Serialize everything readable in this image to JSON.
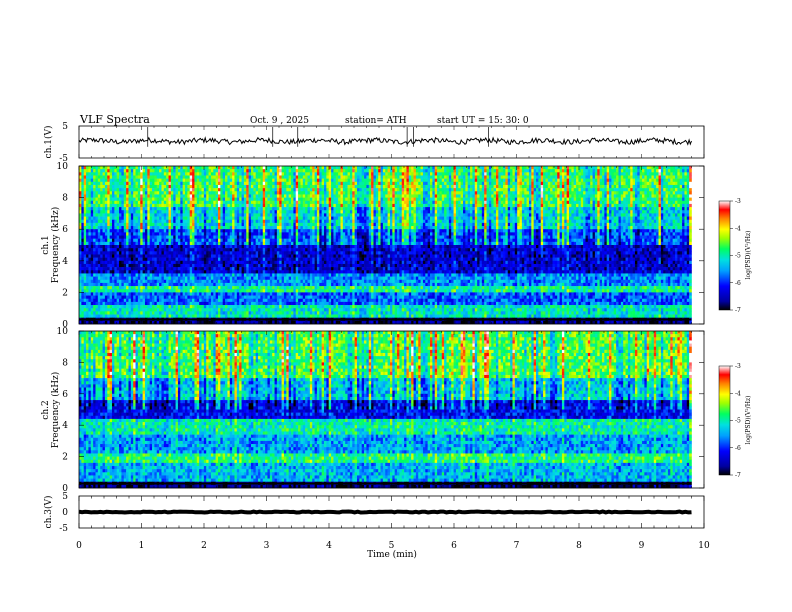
{
  "header": {
    "title": "VLF  Spectra",
    "date": "Oct. 9  , 2025",
    "station": "station= ATH",
    "start_ut": "start  UT  =    15: 30: 0"
  },
  "colors": {
    "background": "#ffffff",
    "axis": "#000000",
    "colormap": [
      "#000000",
      "#0000a0",
      "#0000ff",
      "#00a0ff",
      "#00e0e0",
      "#00ff60",
      "#a0ff00",
      "#ffff00",
      "#ff8000",
      "#ff0000",
      "#ffffff"
    ]
  },
  "chart_data": [
    {
      "type": "line",
      "panel": "ch1-waveform",
      "ylabel": "ch.1(V)",
      "xlim": [
        0,
        10
      ],
      "ylim": [
        -5,
        5
      ],
      "yticks": [
        "5",
        "-5"
      ],
      "trace_range_min": [
        0,
        9.8
      ],
      "baseline_v": 0.3,
      "noise_amplitude_v": 0.8,
      "spike_times_min": [
        1.1,
        3.1,
        3.5,
        5.25,
        5.35,
        6.55
      ]
    },
    {
      "type": "heatmap",
      "panel": "ch1-spectrogram",
      "ylabel_top": "ch.1",
      "ylabel": "Frequency  (kHz)",
      "xlim": [
        0,
        10
      ],
      "ylim": [
        0,
        10
      ],
      "yticks": [
        "0",
        "2",
        "4",
        "6",
        "8",
        "10"
      ],
      "data_extent_min": [
        0,
        9.8
      ],
      "colorbar": {
        "label": "log(PSD)(V²/Hz)",
        "ticks": [
          "-3",
          "-4",
          "-5",
          "-6",
          "-7"
        ],
        "range": [
          -7,
          -3
        ]
      },
      "bands_khz": [
        {
          "from": 0,
          "to": 0.4,
          "log_psd": -6.8
        },
        {
          "from": 0.4,
          "to": 1.3,
          "log_psd": -5.1
        },
        {
          "from": 1.3,
          "to": 2.0,
          "log_psd": -5.8
        },
        {
          "from": 2.0,
          "to": 2.4,
          "log_psd": -4.9
        },
        {
          "from": 2.4,
          "to": 3.3,
          "log_psd": -5.6
        },
        {
          "from": 3.3,
          "to": 5.0,
          "log_psd": -6.4
        },
        {
          "from": 5.0,
          "to": 6.0,
          "log_psd": -5.8
        },
        {
          "from": 6.0,
          "to": 7.5,
          "log_psd": -5.2
        },
        {
          "from": 7.5,
          "to": 10.0,
          "log_psd": -4.7
        }
      ]
    },
    {
      "type": "heatmap",
      "panel": "ch2-spectrogram",
      "ylabel_top": "ch.2",
      "ylabel": "Frequency  (kHz)",
      "xlim": [
        0,
        10
      ],
      "ylim": [
        0,
        10
      ],
      "yticks": [
        "0",
        "2",
        "4",
        "6",
        "8",
        "10"
      ],
      "data_extent_min": [
        0,
        9.8
      ],
      "colorbar": {
        "label": "log(PSD)(V²/Hz)",
        "ticks": [
          "-3",
          "-4",
          "-5",
          "-6",
          "-7"
        ],
        "range": [
          -7,
          -3
        ]
      },
      "bands_khz": [
        {
          "from": 0,
          "to": 0.4,
          "log_psd": -6.8
        },
        {
          "from": 0.4,
          "to": 1.6,
          "log_psd": -5.4
        },
        {
          "from": 1.6,
          "to": 2.3,
          "log_psd": -4.8
        },
        {
          "from": 2.3,
          "to": 3.4,
          "log_psd": -5.5
        },
        {
          "from": 3.4,
          "to": 4.5,
          "log_psd": -5.0
        },
        {
          "from": 4.5,
          "to": 5.6,
          "log_psd": -6.2
        },
        {
          "from": 5.6,
          "to": 7.0,
          "log_psd": -5.3
        },
        {
          "from": 7.0,
          "to": 10.0,
          "log_psd": -4.6
        }
      ]
    },
    {
      "type": "line",
      "panel": "ch3-waveform",
      "ylabel": "ch.3(V)",
      "xlabel": "Time  (min)",
      "xlim": [
        0,
        10
      ],
      "ylim": [
        -5,
        5
      ],
      "yticks": [
        "5",
        "0",
        "-5"
      ],
      "xticks": [
        "0",
        "1",
        "2",
        "3",
        "4",
        "5",
        "6",
        "7",
        "8",
        "9",
        "10"
      ],
      "trace_range_min": [
        0,
        9.8
      ],
      "baseline_v": 0.0,
      "noise_amplitude_v": 0.15
    }
  ]
}
